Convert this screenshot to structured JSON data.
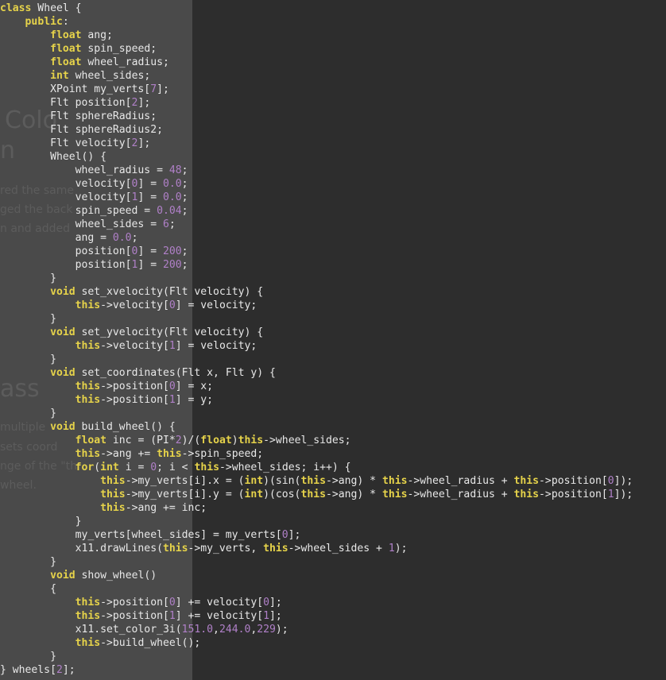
{
  "ghost_text": {
    "heading1": "Colo",
    "heading2": "n",
    "para1": "red the same",
    "para2": "ged the back",
    "para3": "n and added",
    "heading3": "ass",
    "para4": "multiple",
    "para5": "sets coord",
    "para6": "nge of the \"th",
    "para7": "wheel."
  },
  "code_lines": [
    [
      [
        "kw",
        "class"
      ],
      [
        "t",
        " Wheel {"
      ]
    ],
    [
      [
        "t",
        "    "
      ],
      [
        "kw",
        "public"
      ],
      [
        "t",
        ":"
      ]
    ],
    [
      [
        "t",
        "        "
      ],
      [
        "kw",
        "float"
      ],
      [
        "t",
        " ang;"
      ]
    ],
    [
      [
        "t",
        "        "
      ],
      [
        "kw",
        "float"
      ],
      [
        "t",
        " spin_speed;"
      ]
    ],
    [
      [
        "t",
        "        "
      ],
      [
        "kw",
        "float"
      ],
      [
        "t",
        " wheel_radius;"
      ]
    ],
    [
      [
        "t",
        "        "
      ],
      [
        "kw",
        "int"
      ],
      [
        "t",
        " wheel_sides;"
      ]
    ],
    [
      [
        "t",
        "        XPoint my_verts["
      ],
      [
        "num",
        "7"
      ],
      [
        "t",
        "];"
      ]
    ],
    [
      [
        "t",
        "        Flt position["
      ],
      [
        "num",
        "2"
      ],
      [
        "t",
        "];"
      ]
    ],
    [
      [
        "t",
        "        Flt sphereRadius;"
      ]
    ],
    [
      [
        "t",
        "        Flt sphereRadius2;"
      ]
    ],
    [
      [
        "t",
        "        Flt velocity["
      ],
      [
        "num",
        "2"
      ],
      [
        "t",
        "];"
      ]
    ],
    [
      [
        "t",
        "        Wheel() {"
      ]
    ],
    [
      [
        "t",
        "            wheel_radius = "
      ],
      [
        "num",
        "48"
      ],
      [
        "t",
        ";"
      ]
    ],
    [
      [
        "t",
        "            velocity["
      ],
      [
        "num",
        "0"
      ],
      [
        "t",
        "] = "
      ],
      [
        "num",
        "0.0"
      ],
      [
        "t",
        ";"
      ]
    ],
    [
      [
        "t",
        "            velocity["
      ],
      [
        "num",
        "1"
      ],
      [
        "t",
        "] = "
      ],
      [
        "num",
        "0.0"
      ],
      [
        "t",
        ";"
      ]
    ],
    [
      [
        "t",
        "            spin_speed = "
      ],
      [
        "num",
        "0.04"
      ],
      [
        "t",
        ";"
      ]
    ],
    [
      [
        "t",
        "            wheel_sides = "
      ],
      [
        "num",
        "6"
      ],
      [
        "t",
        ";"
      ]
    ],
    [
      [
        "t",
        "            ang = "
      ],
      [
        "num",
        "0.0"
      ],
      [
        "t",
        ";"
      ]
    ],
    [
      [
        "t",
        "            position["
      ],
      [
        "num",
        "0"
      ],
      [
        "t",
        "] = "
      ],
      [
        "num",
        "200"
      ],
      [
        "t",
        ";"
      ]
    ],
    [
      [
        "t",
        "            position["
      ],
      [
        "num",
        "1"
      ],
      [
        "t",
        "] = "
      ],
      [
        "num",
        "200"
      ],
      [
        "t",
        ";"
      ]
    ],
    [
      [
        "t",
        "        }"
      ]
    ],
    [
      [
        "t",
        "        "
      ],
      [
        "kw",
        "void"
      ],
      [
        "t",
        " set_xvelocity(Flt velocity) {"
      ]
    ],
    [
      [
        "t",
        "            "
      ],
      [
        "kw",
        "this"
      ],
      [
        "t",
        "->velocity["
      ],
      [
        "num",
        "0"
      ],
      [
        "t",
        "] = velocity;"
      ]
    ],
    [
      [
        "t",
        "        }"
      ]
    ],
    [
      [
        "t",
        "        "
      ],
      [
        "kw",
        "void"
      ],
      [
        "t",
        " set_yvelocity(Flt velocity) {"
      ]
    ],
    [
      [
        "t",
        "            "
      ],
      [
        "kw",
        "this"
      ],
      [
        "t",
        "->velocity["
      ],
      [
        "num",
        "1"
      ],
      [
        "t",
        "] = velocity;"
      ]
    ],
    [
      [
        "t",
        "        }"
      ]
    ],
    [
      [
        "t",
        "        "
      ],
      [
        "kw",
        "void"
      ],
      [
        "t",
        " set_coordinates(Flt x, Flt y) {"
      ]
    ],
    [
      [
        "t",
        "            "
      ],
      [
        "kw",
        "this"
      ],
      [
        "t",
        "->position["
      ],
      [
        "num",
        "0"
      ],
      [
        "t",
        "] = x;"
      ]
    ],
    [
      [
        "t",
        "            "
      ],
      [
        "kw",
        "this"
      ],
      [
        "t",
        "->position["
      ],
      [
        "num",
        "1"
      ],
      [
        "t",
        "] = y;"
      ]
    ],
    [
      [
        "t",
        "        }"
      ]
    ],
    [
      [
        "t",
        "        "
      ],
      [
        "kw",
        "void"
      ],
      [
        "t",
        " build_wheel() {"
      ]
    ],
    [
      [
        "t",
        "            "
      ],
      [
        "kw",
        "float"
      ],
      [
        "t",
        " inc = (PI*"
      ],
      [
        "num",
        "2"
      ],
      [
        "t",
        ")/("
      ],
      [
        "kw",
        "float"
      ],
      [
        "t",
        ")"
      ],
      [
        "kw",
        "this"
      ],
      [
        "t",
        "->wheel_sides;"
      ]
    ],
    [
      [
        "t",
        "            "
      ],
      [
        "kw",
        "this"
      ],
      [
        "t",
        "->ang += "
      ],
      [
        "kw",
        "this"
      ],
      [
        "t",
        "->spin_speed;"
      ]
    ],
    [
      [
        "t",
        "            "
      ],
      [
        "kw",
        "for"
      ],
      [
        "t",
        "("
      ],
      [
        "kw",
        "int"
      ],
      [
        "t",
        " i = "
      ],
      [
        "num",
        "0"
      ],
      [
        "t",
        "; i < "
      ],
      [
        "kw",
        "this"
      ],
      [
        "t",
        "->wheel_sides; i++) {"
      ]
    ],
    [
      [
        "t",
        "                "
      ],
      [
        "kw",
        "this"
      ],
      [
        "t",
        "->my_verts[i].x = ("
      ],
      [
        "kw",
        "int"
      ],
      [
        "t",
        ")(sin("
      ],
      [
        "kw",
        "this"
      ],
      [
        "t",
        "->ang) * "
      ],
      [
        "kw",
        "this"
      ],
      [
        "t",
        "->wheel_radius + "
      ],
      [
        "kw",
        "this"
      ],
      [
        "t",
        "->position["
      ],
      [
        "num",
        "0"
      ],
      [
        "t",
        "]);"
      ]
    ],
    [
      [
        "t",
        "                "
      ],
      [
        "kw",
        "this"
      ],
      [
        "t",
        "->my_verts[i].y = ("
      ],
      [
        "kw",
        "int"
      ],
      [
        "t",
        ")(cos("
      ],
      [
        "kw",
        "this"
      ],
      [
        "t",
        "->ang) * "
      ],
      [
        "kw",
        "this"
      ],
      [
        "t",
        "->wheel_radius + "
      ],
      [
        "kw",
        "this"
      ],
      [
        "t",
        "->position["
      ],
      [
        "num",
        "1"
      ],
      [
        "t",
        "]);"
      ]
    ],
    [
      [
        "t",
        "                "
      ],
      [
        "kw",
        "this"
      ],
      [
        "t",
        "->ang += inc;"
      ]
    ],
    [
      [
        "t",
        "            }"
      ]
    ],
    [
      [
        "t",
        "            my_verts[wheel_sides] = my_verts["
      ],
      [
        "num",
        "0"
      ],
      [
        "t",
        "];"
      ]
    ],
    [
      [
        "t",
        "            x11.drawLines("
      ],
      [
        "kw",
        "this"
      ],
      [
        "t",
        "->my_verts, "
      ],
      [
        "kw",
        "this"
      ],
      [
        "t",
        "->wheel_sides + "
      ],
      [
        "num",
        "1"
      ],
      [
        "t",
        ");"
      ]
    ],
    [
      [
        "t",
        "        }"
      ]
    ],
    [
      [
        "t",
        "        "
      ],
      [
        "kw",
        "void"
      ],
      [
        "t",
        " show_wheel()"
      ]
    ],
    [
      [
        "t",
        "        {"
      ]
    ],
    [
      [
        "t",
        "            "
      ],
      [
        "kw",
        "this"
      ],
      [
        "t",
        "->position["
      ],
      [
        "num",
        "0"
      ],
      [
        "t",
        "] += velocity["
      ],
      [
        "num",
        "0"
      ],
      [
        "t",
        "];"
      ]
    ],
    [
      [
        "t",
        "            "
      ],
      [
        "kw",
        "this"
      ],
      [
        "t",
        "->position["
      ],
      [
        "num",
        "1"
      ],
      [
        "t",
        "] += velocity["
      ],
      [
        "num",
        "1"
      ],
      [
        "t",
        "];"
      ]
    ],
    [
      [
        "t",
        "            x11.set_color_3i("
      ],
      [
        "num",
        "151.0"
      ],
      [
        "t",
        ","
      ],
      [
        "num",
        "244.0"
      ],
      [
        "t",
        ","
      ],
      [
        "num",
        "229"
      ],
      [
        "t",
        ");"
      ]
    ],
    [
      [
        "t",
        "            "
      ],
      [
        "kw",
        "this"
      ],
      [
        "t",
        "->build_wheel();"
      ]
    ],
    [
      [
        "t",
        "        }"
      ]
    ],
    [
      [
        "t",
        "} wheels["
      ],
      [
        "num",
        "2"
      ],
      [
        "t",
        "];"
      ]
    ]
  ],
  "colors": {
    "keyword": "#e6d34a",
    "number": "#b080c8",
    "text": "#e8e8e8",
    "left_panel": "#4a4a4a",
    "editor_bg": "#2d2d2d"
  }
}
